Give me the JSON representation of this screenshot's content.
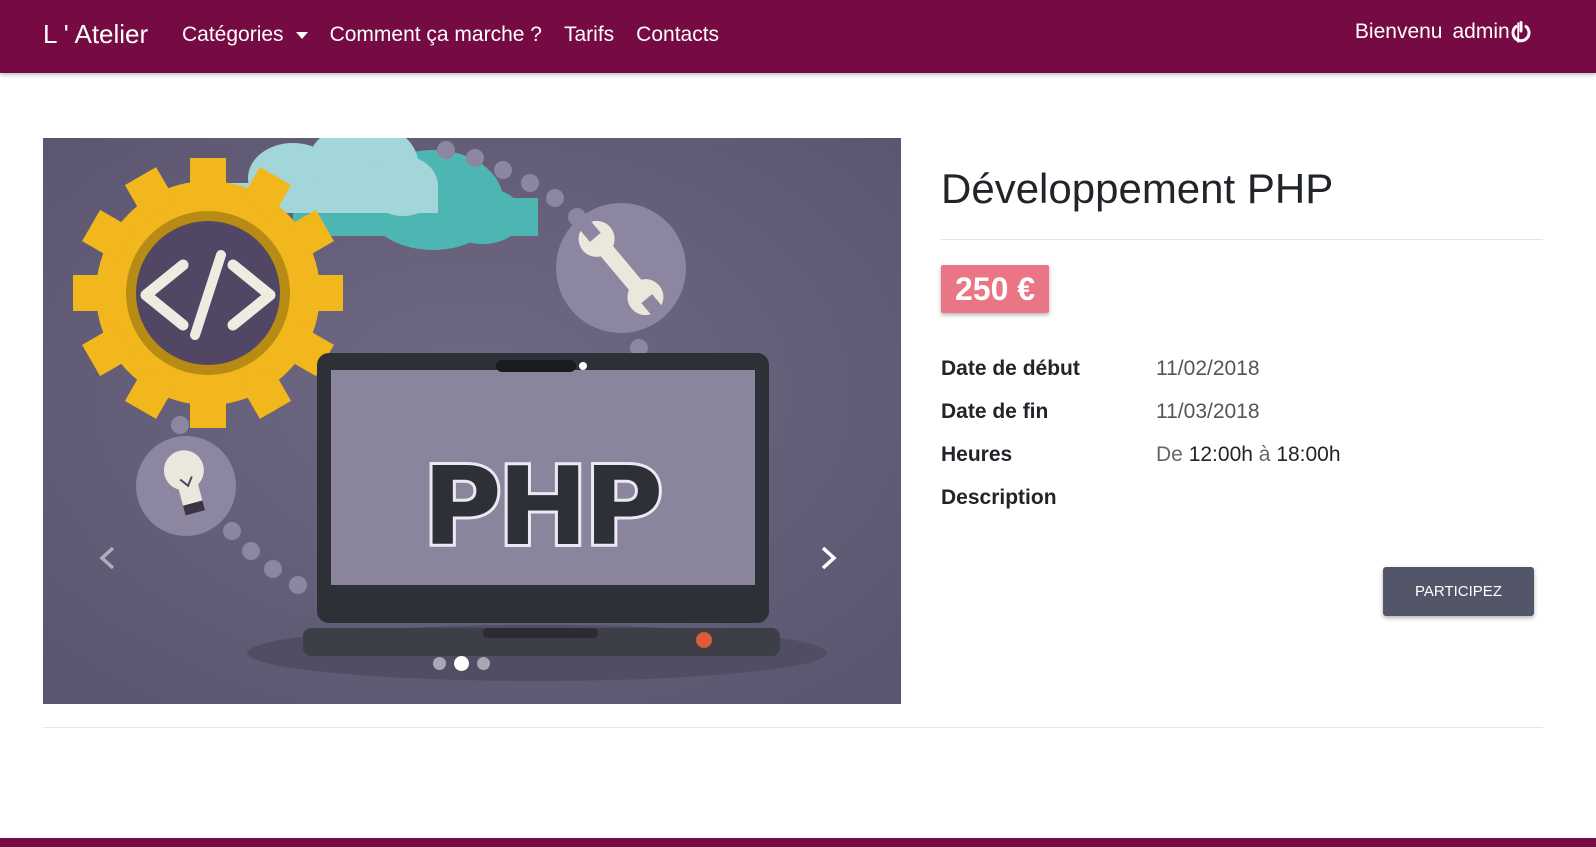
{
  "navbar": {
    "brand": "L ' Atelier",
    "links": [
      {
        "label": "Catégories"
      },
      {
        "label": "Comment ça marche ?"
      },
      {
        "label": "Tarifs"
      },
      {
        "label": "Contacts"
      }
    ],
    "welcome": "Bienvenu",
    "username": "admin |",
    "logout_icon": "power-icon",
    "color": "#760b43"
  },
  "carousel": {
    "image_text": "PHP",
    "slide_count": 3,
    "active_slide": 2,
    "prev_icon": "chevron-left-icon",
    "next_icon": "chevron-right-icon"
  },
  "course": {
    "title": "Développement PHP",
    "price": "250 €",
    "price_color": "#ea7685",
    "details": {
      "start_label": "Date de début",
      "start_value": "11/02/2018",
      "end_label": "Date de fin",
      "end_value": "11/03/2018",
      "hours_label": "Heures",
      "hours_prefix": "De",
      "hours_start": "12:00h",
      "hours_mid": "à",
      "hours_end": "18:00h",
      "description_label": "Description"
    },
    "button_label": "Participez"
  }
}
